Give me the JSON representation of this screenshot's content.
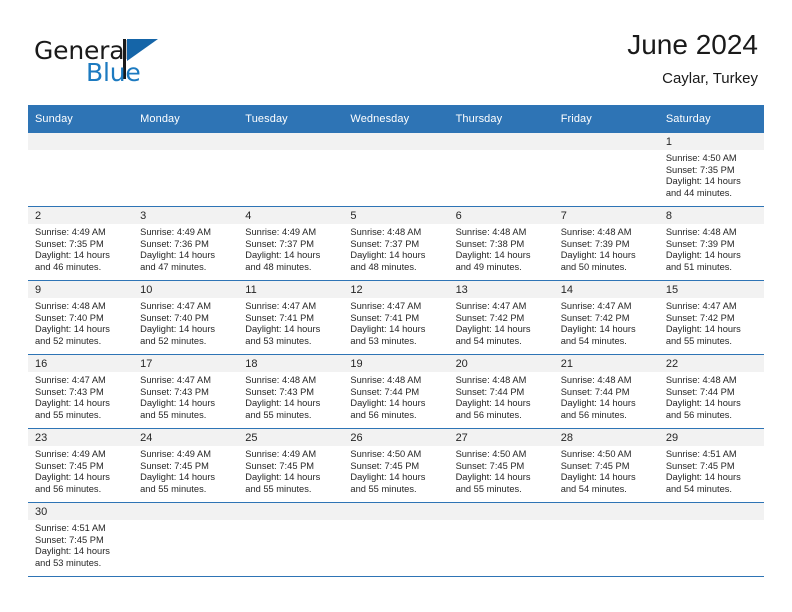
{
  "brand": {
    "name_part1": "General",
    "name_part2": "Blue",
    "flag_icon": "triangle-flag-icon",
    "accent_color": "#1C7AC0"
  },
  "header": {
    "title": "June 2024",
    "subtitle": "Caylar, Turkey"
  },
  "theme": {
    "header_bg": "#2E74B5",
    "daynum_bg": "#F2F2F2",
    "text": "#262626"
  },
  "calendar": {
    "weekday_headers": [
      "Sunday",
      "Monday",
      "Tuesday",
      "Wednesday",
      "Thursday",
      "Friday",
      "Saturday"
    ],
    "weeks": [
      [
        {
          "day": "",
          "empty": true
        },
        {
          "day": "",
          "empty": true
        },
        {
          "day": "",
          "empty": true
        },
        {
          "day": "",
          "empty": true
        },
        {
          "day": "",
          "empty": true
        },
        {
          "day": "",
          "empty": true
        },
        {
          "day": "1",
          "sunrise": "Sunrise: 4:50 AM",
          "sunset": "Sunset: 7:35 PM",
          "daylight_line1": "Daylight: 14 hours",
          "daylight_line2": "and 44 minutes."
        }
      ],
      [
        {
          "day": "2",
          "sunrise": "Sunrise: 4:49 AM",
          "sunset": "Sunset: 7:35 PM",
          "daylight_line1": "Daylight: 14 hours",
          "daylight_line2": "and 46 minutes."
        },
        {
          "day": "3",
          "sunrise": "Sunrise: 4:49 AM",
          "sunset": "Sunset: 7:36 PM",
          "daylight_line1": "Daylight: 14 hours",
          "daylight_line2": "and 47 minutes."
        },
        {
          "day": "4",
          "sunrise": "Sunrise: 4:49 AM",
          "sunset": "Sunset: 7:37 PM",
          "daylight_line1": "Daylight: 14 hours",
          "daylight_line2": "and 48 minutes."
        },
        {
          "day": "5",
          "sunrise": "Sunrise: 4:48 AM",
          "sunset": "Sunset: 7:37 PM",
          "daylight_line1": "Daylight: 14 hours",
          "daylight_line2": "and 48 minutes."
        },
        {
          "day": "6",
          "sunrise": "Sunrise: 4:48 AM",
          "sunset": "Sunset: 7:38 PM",
          "daylight_line1": "Daylight: 14 hours",
          "daylight_line2": "and 49 minutes."
        },
        {
          "day": "7",
          "sunrise": "Sunrise: 4:48 AM",
          "sunset": "Sunset: 7:39 PM",
          "daylight_line1": "Daylight: 14 hours",
          "daylight_line2": "and 50 minutes."
        },
        {
          "day": "8",
          "sunrise": "Sunrise: 4:48 AM",
          "sunset": "Sunset: 7:39 PM",
          "daylight_line1": "Daylight: 14 hours",
          "daylight_line2": "and 51 minutes."
        }
      ],
      [
        {
          "day": "9",
          "sunrise": "Sunrise: 4:48 AM",
          "sunset": "Sunset: 7:40 PM",
          "daylight_line1": "Daylight: 14 hours",
          "daylight_line2": "and 52 minutes."
        },
        {
          "day": "10",
          "sunrise": "Sunrise: 4:47 AM",
          "sunset": "Sunset: 7:40 PM",
          "daylight_line1": "Daylight: 14 hours",
          "daylight_line2": "and 52 minutes."
        },
        {
          "day": "11",
          "sunrise": "Sunrise: 4:47 AM",
          "sunset": "Sunset: 7:41 PM",
          "daylight_line1": "Daylight: 14 hours",
          "daylight_line2": "and 53 minutes."
        },
        {
          "day": "12",
          "sunrise": "Sunrise: 4:47 AM",
          "sunset": "Sunset: 7:41 PM",
          "daylight_line1": "Daylight: 14 hours",
          "daylight_line2": "and 53 minutes."
        },
        {
          "day": "13",
          "sunrise": "Sunrise: 4:47 AM",
          "sunset": "Sunset: 7:42 PM",
          "daylight_line1": "Daylight: 14 hours",
          "daylight_line2": "and 54 minutes."
        },
        {
          "day": "14",
          "sunrise": "Sunrise: 4:47 AM",
          "sunset": "Sunset: 7:42 PM",
          "daylight_line1": "Daylight: 14 hours",
          "daylight_line2": "and 54 minutes."
        },
        {
          "day": "15",
          "sunrise": "Sunrise: 4:47 AM",
          "sunset": "Sunset: 7:42 PM",
          "daylight_line1": "Daylight: 14 hours",
          "daylight_line2": "and 55 minutes."
        }
      ],
      [
        {
          "day": "16",
          "sunrise": "Sunrise: 4:47 AM",
          "sunset": "Sunset: 7:43 PM",
          "daylight_line1": "Daylight: 14 hours",
          "daylight_line2": "and 55 minutes."
        },
        {
          "day": "17",
          "sunrise": "Sunrise: 4:47 AM",
          "sunset": "Sunset: 7:43 PM",
          "daylight_line1": "Daylight: 14 hours",
          "daylight_line2": "and 55 minutes."
        },
        {
          "day": "18",
          "sunrise": "Sunrise: 4:48 AM",
          "sunset": "Sunset: 7:43 PM",
          "daylight_line1": "Daylight: 14 hours",
          "daylight_line2": "and 55 minutes."
        },
        {
          "day": "19",
          "sunrise": "Sunrise: 4:48 AM",
          "sunset": "Sunset: 7:44 PM",
          "daylight_line1": "Daylight: 14 hours",
          "daylight_line2": "and 56 minutes."
        },
        {
          "day": "20",
          "sunrise": "Sunrise: 4:48 AM",
          "sunset": "Sunset: 7:44 PM",
          "daylight_line1": "Daylight: 14 hours",
          "daylight_line2": "and 56 minutes."
        },
        {
          "day": "21",
          "sunrise": "Sunrise: 4:48 AM",
          "sunset": "Sunset: 7:44 PM",
          "daylight_line1": "Daylight: 14 hours",
          "daylight_line2": "and 56 minutes."
        },
        {
          "day": "22",
          "sunrise": "Sunrise: 4:48 AM",
          "sunset": "Sunset: 7:44 PM",
          "daylight_line1": "Daylight: 14 hours",
          "daylight_line2": "and 56 minutes."
        }
      ],
      [
        {
          "day": "23",
          "sunrise": "Sunrise: 4:49 AM",
          "sunset": "Sunset: 7:45 PM",
          "daylight_line1": "Daylight: 14 hours",
          "daylight_line2": "and 56 minutes."
        },
        {
          "day": "24",
          "sunrise": "Sunrise: 4:49 AM",
          "sunset": "Sunset: 7:45 PM",
          "daylight_line1": "Daylight: 14 hours",
          "daylight_line2": "and 55 minutes."
        },
        {
          "day": "25",
          "sunrise": "Sunrise: 4:49 AM",
          "sunset": "Sunset: 7:45 PM",
          "daylight_line1": "Daylight: 14 hours",
          "daylight_line2": "and 55 minutes."
        },
        {
          "day": "26",
          "sunrise": "Sunrise: 4:50 AM",
          "sunset": "Sunset: 7:45 PM",
          "daylight_line1": "Daylight: 14 hours",
          "daylight_line2": "and 55 minutes."
        },
        {
          "day": "27",
          "sunrise": "Sunrise: 4:50 AM",
          "sunset": "Sunset: 7:45 PM",
          "daylight_line1": "Daylight: 14 hours",
          "daylight_line2": "and 55 minutes."
        },
        {
          "day": "28",
          "sunrise": "Sunrise: 4:50 AM",
          "sunset": "Sunset: 7:45 PM",
          "daylight_line1": "Daylight: 14 hours",
          "daylight_line2": "and 54 minutes."
        },
        {
          "day": "29",
          "sunrise": "Sunrise: 4:51 AM",
          "sunset": "Sunset: 7:45 PM",
          "daylight_line1": "Daylight: 14 hours",
          "daylight_line2": "and 54 minutes."
        }
      ],
      [
        {
          "day": "30",
          "sunrise": "Sunrise: 4:51 AM",
          "sunset": "Sunset: 7:45 PM",
          "daylight_line1": "Daylight: 14 hours",
          "daylight_line2": "and 53 minutes."
        },
        {
          "day": "",
          "empty": true
        },
        {
          "day": "",
          "empty": true
        },
        {
          "day": "",
          "empty": true
        },
        {
          "day": "",
          "empty": true
        },
        {
          "day": "",
          "empty": true
        },
        {
          "day": "",
          "empty": true
        }
      ]
    ]
  }
}
